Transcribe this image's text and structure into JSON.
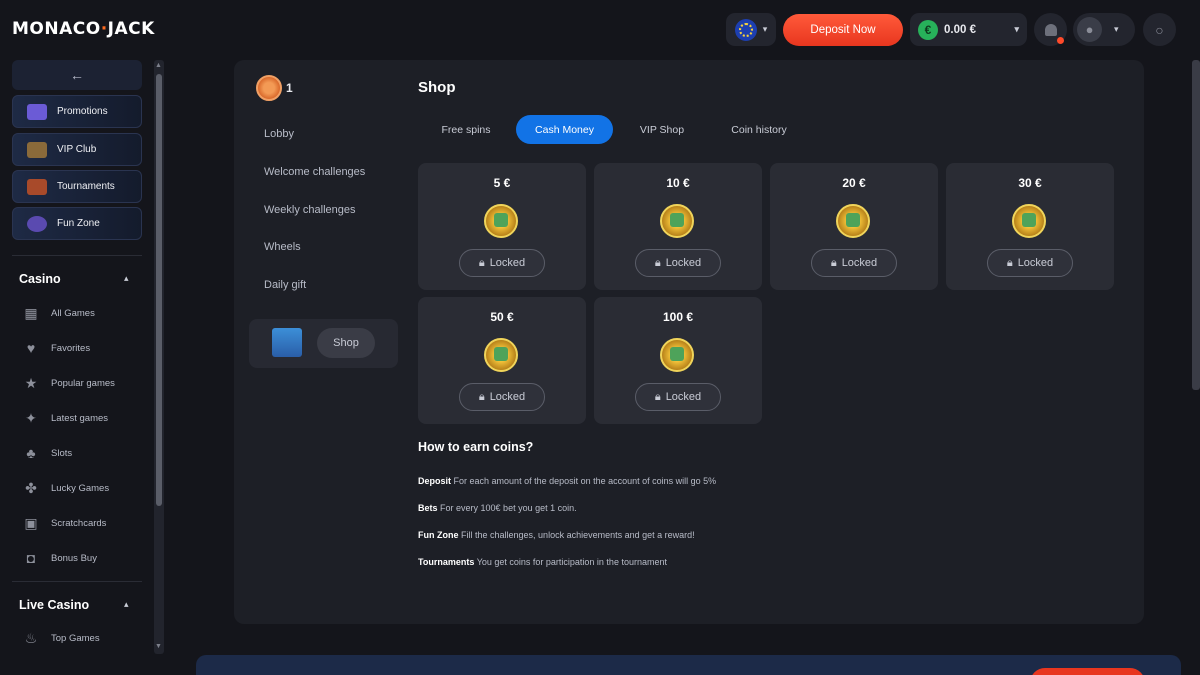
{
  "header": {
    "logo": {
      "left": "MONACO",
      "dot": "·",
      "right": "JACK"
    },
    "deposit_label": "Deposit Now",
    "balance": "0.00 €",
    "euro_symbol": "€",
    "colors": {
      "accent": "#ff5a3a",
      "active_tab": "#1273e6"
    }
  },
  "sidebar": {
    "back_icon": "←",
    "promos": [
      {
        "label": "Promotions",
        "icon": "promotions-icon"
      },
      {
        "label": "VIP Club",
        "icon": "vip-icon"
      },
      {
        "label": "Tournaments",
        "icon": "tournaments-icon"
      },
      {
        "label": "Fun Zone",
        "icon": "fun-zone-icon"
      }
    ],
    "casino_title": "Casino",
    "casino_items": [
      {
        "label": "All Games",
        "icon": "grid-icon"
      },
      {
        "label": "Favorites",
        "icon": "heart-icon"
      },
      {
        "label": "Popular games",
        "icon": "star-icon"
      },
      {
        "label": "Latest games",
        "icon": "sparkle-icon"
      },
      {
        "label": "Slots",
        "icon": "cherry-icon"
      },
      {
        "label": "Lucky Games",
        "icon": "clover-icon"
      },
      {
        "label": "Scratchcards",
        "icon": "scratch-icon"
      },
      {
        "label": "Bonus Buy",
        "icon": "gift-icon"
      }
    ],
    "live_title": "Live Casino",
    "live_items": [
      {
        "label": "Top Games",
        "icon": "flame-icon"
      }
    ]
  },
  "panel": {
    "coin_count": "1",
    "left_menu": [
      "Lobby",
      "Welcome challenges",
      "Weekly challenges",
      "Wheels",
      "Daily gift"
    ],
    "shop_label": "Shop",
    "title": "Shop",
    "tabs": [
      {
        "label": "Free spins",
        "active": false
      },
      {
        "label": "Cash Money",
        "active": true
      },
      {
        "label": "VIP Shop",
        "active": false
      },
      {
        "label": "Coin history",
        "active": false
      }
    ],
    "cards": [
      {
        "title": "5 €",
        "status": "Locked"
      },
      {
        "title": "10 €",
        "status": "Locked"
      },
      {
        "title": "20 €",
        "status": "Locked"
      },
      {
        "title": "30 €",
        "status": "Locked"
      },
      {
        "title": "50 €",
        "status": "Locked"
      },
      {
        "title": "100 €",
        "status": "Locked"
      }
    ],
    "earn_title": "How to earn coins?",
    "earn_rules": [
      {
        "key": "Deposit",
        "text": "For each amount of the deposit on the account of coins will go 5%"
      },
      {
        "key": "Bets",
        "text": "For every 100€ bet you get 1 coin."
      },
      {
        "key": "Fun Zone",
        "text": "Fill the challenges, unlock achievements and get a reward!"
      },
      {
        "key": "Tournaments",
        "text": "You get coins for participation in the tournament"
      }
    ]
  }
}
